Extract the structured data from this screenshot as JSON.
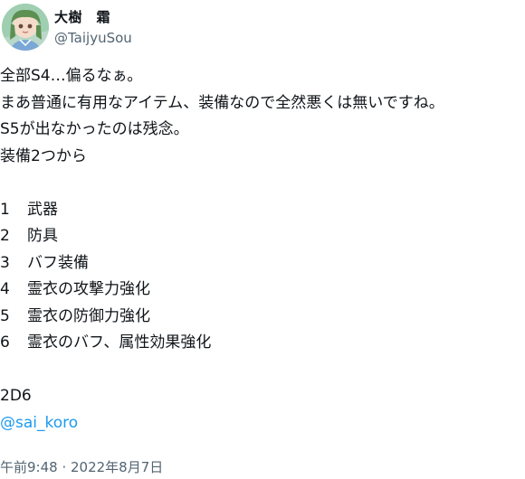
{
  "author": {
    "display_name": "大樹　霜",
    "handle": "@TaijyuSou",
    "avatar_icon": "user-avatar"
  },
  "tweet": {
    "lines": [
      "全部S4…偏るなぁ。",
      "まあ普通に有用なアイテム、装備なので全然悪くは無いですね。",
      "S5が出なかったのは残念。",
      "装備2つから"
    ],
    "list": [
      {
        "num": "1",
        "label": "武器"
      },
      {
        "num": "2",
        "label": "防具"
      },
      {
        "num": "3",
        "label": "バフ装備"
      },
      {
        "num": "4",
        "label": "霊衣の攻撃力強化"
      },
      {
        "num": "5",
        "label": "霊衣の防御力強化"
      },
      {
        "num": "6",
        "label": "霊衣のバフ、属性効果強化"
      }
    ],
    "dice": "2D6",
    "mention": "@sai_koro"
  },
  "timestamp": "午前9:48 · 2022年8月7日",
  "colors": {
    "text": "#0f1419",
    "secondary": "#536471",
    "link": "#1d9bf0"
  }
}
